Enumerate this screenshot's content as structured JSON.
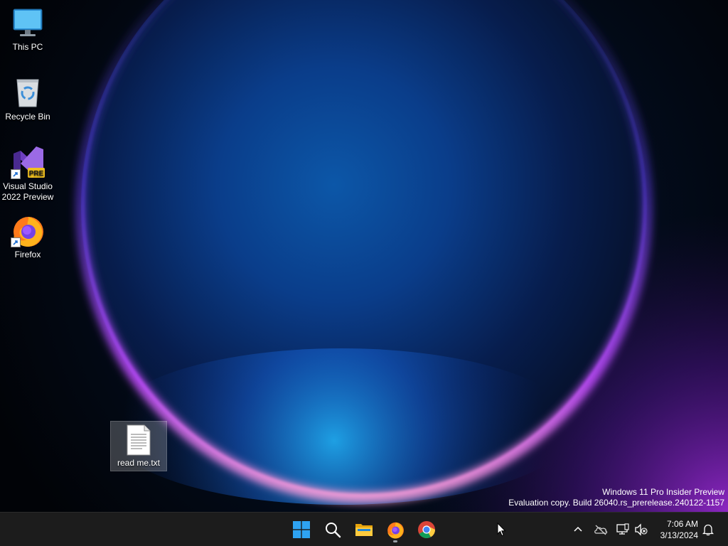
{
  "desktop": {
    "icons": [
      {
        "label": "This PC",
        "icon": "monitor-icon"
      },
      {
        "label": "Recycle Bin",
        "icon": "recycle-bin-icon"
      },
      {
        "label": "Visual Studio 2022 Preview",
        "icon": "visual-studio-preview-icon",
        "badge": "PRE"
      },
      {
        "label": "Firefox",
        "icon": "firefox-icon"
      },
      {
        "label": "read me.txt",
        "icon": "text-file-icon"
      }
    ]
  },
  "watermark": {
    "line1": "Windows 11 Pro Insider Preview",
    "line2": "Evaluation copy. Build 26040.rs_prerelease.240122-1157"
  },
  "taskbar": {
    "pinned": [
      {
        "name": "Start",
        "icon": "windows-start-icon"
      },
      {
        "name": "Search",
        "icon": "search-icon"
      },
      {
        "name": "File Explorer",
        "icon": "folder-icon"
      },
      {
        "name": "Firefox",
        "icon": "firefox-icon",
        "running": true
      },
      {
        "name": "Google Chrome",
        "icon": "chrome-icon"
      }
    ],
    "tray": {
      "icons": [
        "chevron-up-icon",
        "onedrive-offline-icon",
        "network-icon",
        "volume-muted-icon",
        "notification-bell-icon"
      ]
    },
    "clock": {
      "time": "7:06 AM",
      "date": "3/13/2024"
    }
  },
  "colors": {
    "taskbar_bg": "#1c1c1c",
    "wallpaper_ring": "#c24cff",
    "wallpaper_glow": "#1f8fff"
  }
}
